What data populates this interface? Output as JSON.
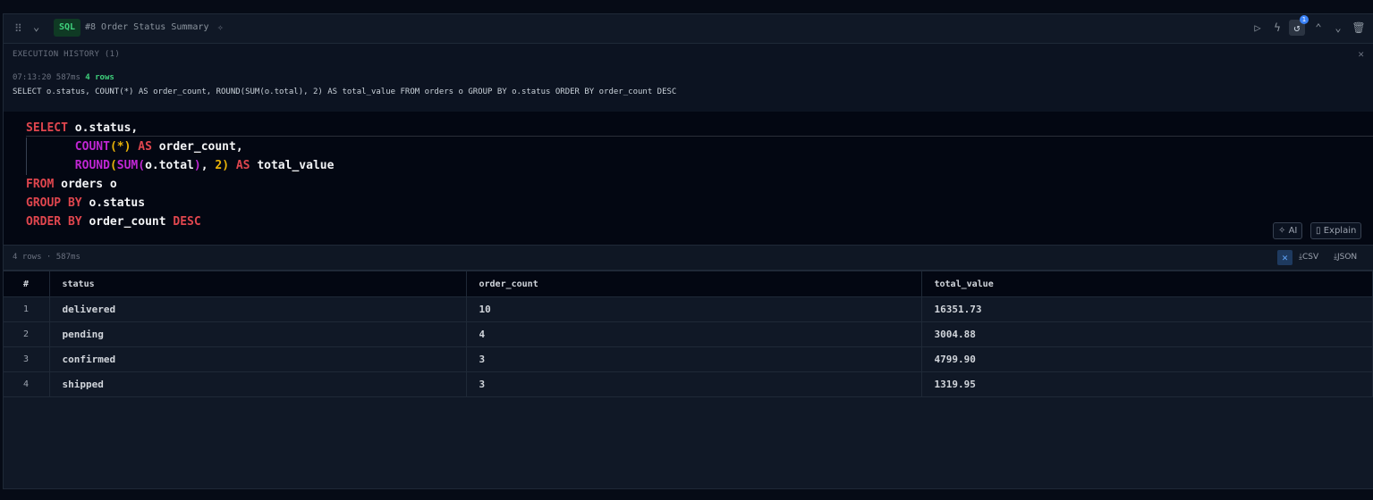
{
  "cell": {
    "language": "SQL",
    "title": "#8 Order Status Summary",
    "history_count_badge": "1"
  },
  "history": {
    "title": "EXECUTION HISTORY (1)",
    "entries": [
      {
        "time": "07:13:20",
        "duration": "587ms",
        "rows": "4 rows",
        "query": "SELECT o.status, COUNT(*) AS order_count, ROUND(SUM(o.total), 2) AS total_value FROM orders o GROUP BY o.status ORDER BY order_count DESC"
      }
    ]
  },
  "editor": {
    "ai_label": "AI",
    "explain_label": "Explain"
  },
  "results": {
    "summary": "4 rows · 587ms",
    "csv_label": "CSV",
    "json_label": "JSON",
    "columns": [
      "#",
      "status",
      "order_count",
      "total_value"
    ],
    "rows": [
      [
        "1",
        "delivered",
        "10",
        "16351.73"
      ],
      [
        "2",
        "pending",
        "4",
        "3004.88"
      ],
      [
        "3",
        "confirmed",
        "3",
        "4799.90"
      ],
      [
        "4",
        "shipped",
        "3",
        "1319.95"
      ]
    ]
  },
  "colors": {
    "keyword": "#e0464e",
    "function": "#c026d3",
    "number": "#eab308",
    "success": "#3fd17c",
    "accent": "#3b82f6"
  }
}
